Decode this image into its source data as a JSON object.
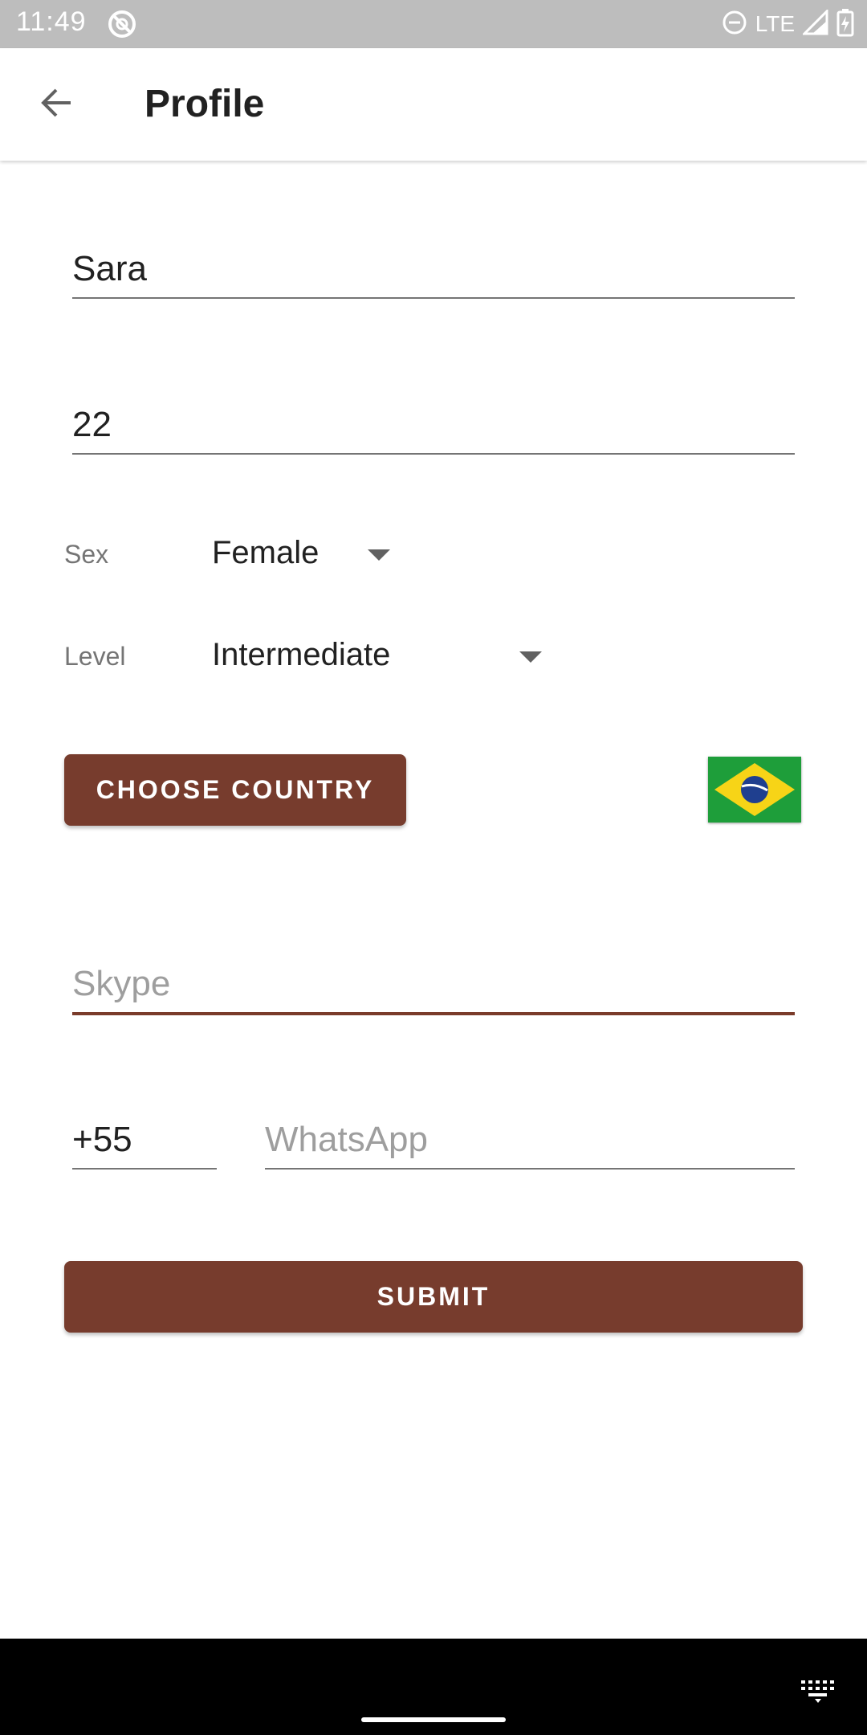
{
  "status_bar": {
    "time": "11:49",
    "network": "LTE",
    "icons": [
      "sync-off-icon",
      "do-not-disturb-icon",
      "signal-icon",
      "battery-charging-icon"
    ]
  },
  "app_bar": {
    "title": "Profile",
    "back_icon": "arrow-back-icon"
  },
  "form": {
    "name_value": "Sara",
    "age_value": "22",
    "sex_label": "Sex",
    "sex_value": "Female",
    "level_label": "Level",
    "level_value": "Intermediate",
    "choose_country_label": "CHOOSE COUNTRY",
    "country_flag": "brazil-flag-icon",
    "skype_placeholder": "Skype",
    "phone_code": "+55",
    "whatsapp_placeholder": "WhatsApp",
    "submit_label": "SUBMIT"
  },
  "colors": {
    "accent": "#773c2d",
    "status_bar": "#bdbdbd",
    "nav_bar": "#000000"
  }
}
